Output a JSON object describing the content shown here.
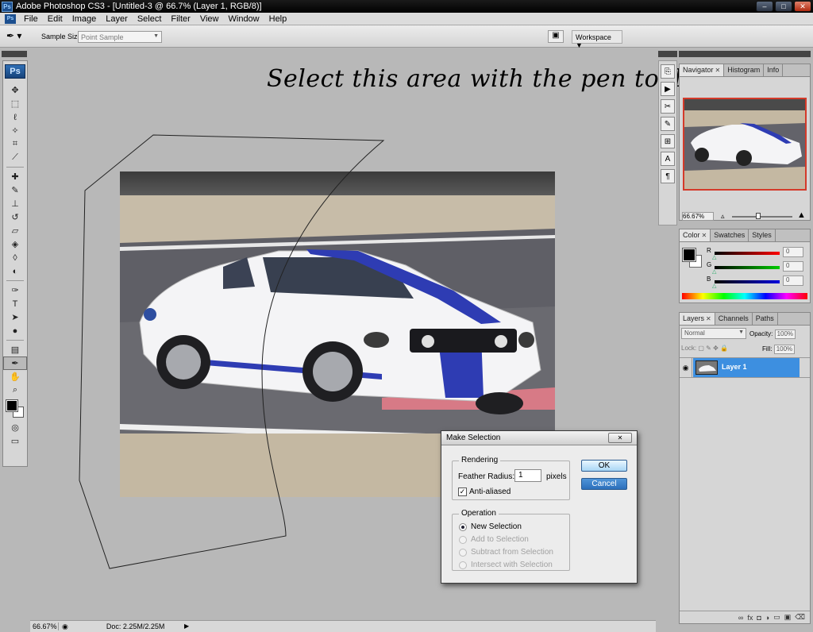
{
  "window": {
    "title": "Adobe Photoshop CS3 - [Untitled-3 @ 66.7% (Layer 1, RGB/8)]",
    "app_badge": "Ps"
  },
  "menu": {
    "items": [
      "File",
      "Edit",
      "Image",
      "Layer",
      "Select",
      "Filter",
      "View",
      "Window",
      "Help"
    ]
  },
  "options": {
    "sample_size_label": "Sample Size:",
    "sample_size_value": "Point Sample",
    "workspace_label": "Workspace ▼"
  },
  "toolbox": {
    "logo": "Ps"
  },
  "canvas": {
    "annotation_text": "Select this area with the pen tool"
  },
  "status": {
    "zoom": "66.67%",
    "doc": "Doc: 2.25M/2.25M"
  },
  "panels": {
    "navigator": {
      "tabs": [
        "Navigator",
        "Histogram",
        "Info"
      ],
      "zoom": "66.67%"
    },
    "color": {
      "tabs": [
        "Color",
        "Swatches",
        "Styles"
      ],
      "channels": [
        {
          "name": "R",
          "value": "0",
          "color": "#ff0000"
        },
        {
          "name": "G",
          "value": "0",
          "color": "#00c000"
        },
        {
          "name": "B",
          "value": "0",
          "color": "#0000d0"
        }
      ]
    },
    "layers": {
      "tabs": [
        "Layers",
        "Channels",
        "Paths"
      ],
      "blend_mode": "Normal",
      "opacity_label": "Opacity:",
      "opacity": "100%",
      "lock_label": "Lock:",
      "fill_label": "Fill:",
      "fill": "100%",
      "layer_name": "Layer 1"
    }
  },
  "dialog": {
    "title": "Make Selection",
    "rendering_label": "Rendering",
    "feather_label": "Feather Radius:",
    "feather_value": "1",
    "feather_unit": "pixels",
    "anti_aliased_label": "Anti-aliased",
    "anti_aliased_checked": true,
    "operation_label": "Operation",
    "operations": [
      {
        "label": "New Selection",
        "selected": true,
        "enabled": true
      },
      {
        "label": "Add to Selection",
        "selected": false,
        "enabled": false
      },
      {
        "label": "Subtract from Selection",
        "selected": false,
        "enabled": false
      },
      {
        "label": "Intersect with Selection",
        "selected": false,
        "enabled": false
      }
    ],
    "ok_label": "OK",
    "cancel_label": "Cancel"
  }
}
